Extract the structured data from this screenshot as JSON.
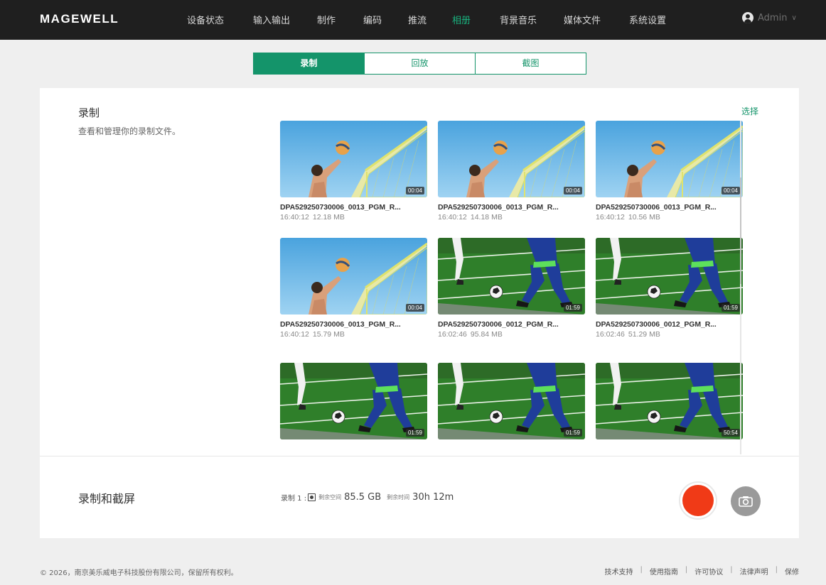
{
  "header": {
    "logo": "MAGEWELL",
    "nav": [
      {
        "label": "设备状态",
        "active": false
      },
      {
        "label": "输入输出",
        "active": false
      },
      {
        "label": "制作",
        "active": false
      },
      {
        "label": "编码",
        "active": false
      },
      {
        "label": "推流",
        "active": false
      },
      {
        "label": "相册",
        "active": true
      },
      {
        "label": "背景音乐",
        "active": false
      },
      {
        "label": "媒体文件",
        "active": false
      },
      {
        "label": "系统设置",
        "active": false
      }
    ],
    "user": "Admin"
  },
  "tabs": [
    {
      "label": "录制",
      "active": true
    },
    {
      "label": "回放",
      "active": false
    },
    {
      "label": "截图",
      "active": false
    }
  ],
  "section": {
    "title": "录制",
    "description": "查看和管理你的录制文件。",
    "select_label": "选择"
  },
  "files": [
    {
      "name": "DPA529250730006_0013_PGM_R...",
      "time": "16:40:12",
      "size": "12.18 MB",
      "duration": "00:04",
      "thumb": "volleyball"
    },
    {
      "name": "DPA529250730006_0013_PGM_R...",
      "time": "16:40:12",
      "size": "14.18 MB",
      "duration": "00:04",
      "thumb": "volleyball"
    },
    {
      "name": "DPA529250730006_0013_PGM_R...",
      "time": "16:40:12",
      "size": "10.56 MB",
      "duration": "00:04",
      "thumb": "volleyball"
    },
    {
      "name": "DPA529250730006_0013_PGM_R...",
      "time": "16:40:12",
      "size": "15.79 MB",
      "duration": "00:04",
      "thumb": "volleyball"
    },
    {
      "name": "DPA529250730006_0012_PGM_R...",
      "time": "16:02:46",
      "size": "95.84 MB",
      "duration": "01:59",
      "thumb": "soccer"
    },
    {
      "name": "DPA529250730006_0012_PGM_R...",
      "time": "16:02:46",
      "size": "51.29 MB",
      "duration": "01:59",
      "thumb": "soccer"
    },
    {
      "name": "",
      "time": "",
      "size": "",
      "duration": "01:59",
      "thumb": "soccer"
    },
    {
      "name": "",
      "time": "",
      "size": "",
      "duration": "01:59",
      "thumb": "soccer"
    },
    {
      "name": "",
      "time": "",
      "size": "",
      "duration": "50:54",
      "thumb": "soccer"
    }
  ],
  "record_bar": {
    "title": "录制和截屏",
    "record_label": "录制 1 :",
    "space_label": "剩余空间",
    "space_value": "85.5 GB",
    "time_label": "剩余时间",
    "time_value": "30h 12m"
  },
  "footer": {
    "copyright": "© 2026，南京美乐威电子科技股份有限公司，保留所有权利。",
    "links": [
      "技术支持",
      "使用指南",
      "许可协议",
      "法律声明",
      "保修"
    ]
  },
  "colors": {
    "accent": "#14946a",
    "nav_active": "#19b37f",
    "record": "#f03a17",
    "topbar": "#1f1f1f"
  }
}
